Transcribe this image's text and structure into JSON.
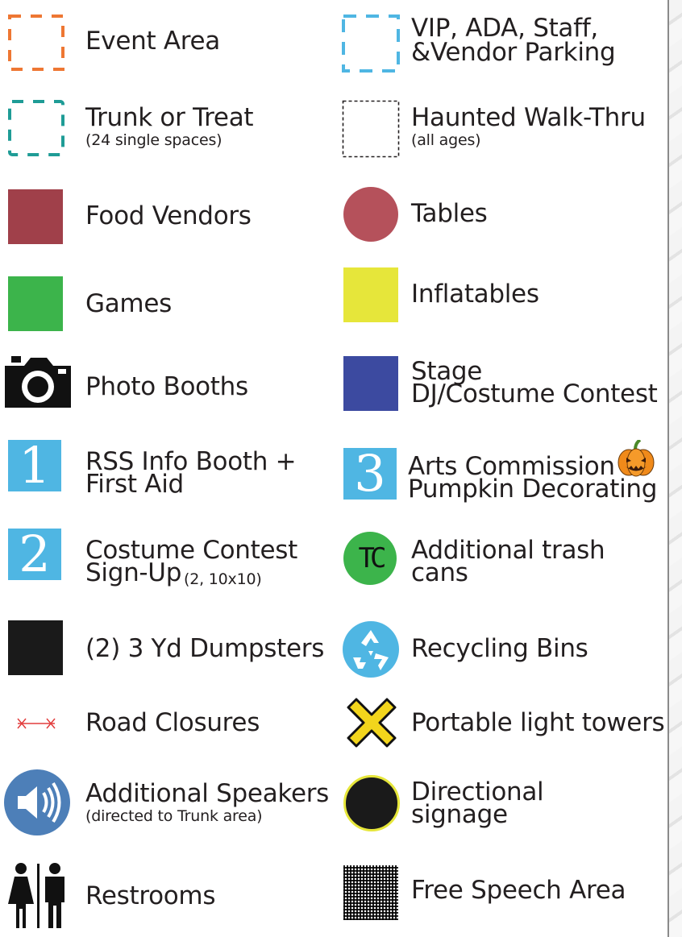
{
  "legend": {
    "left": [
      {
        "key": "event-area",
        "label": "Event Area",
        "icon": "orange-dashed-square-icon",
        "color": "#ee7733"
      },
      {
        "key": "trunk-or-treat",
        "label": "Trunk or Treat",
        "sub": "(24 single spaces)",
        "icon": "teal-dashed-square-icon",
        "color": "#1f9c96"
      },
      {
        "key": "food-vendors",
        "label": "Food Vendors",
        "icon": "maroon-square-icon",
        "color": "#a0404a"
      },
      {
        "key": "games",
        "label": "Games",
        "icon": "green-square-icon",
        "color": "#3cb44b"
      },
      {
        "key": "photo-booths",
        "label": "Photo Booths",
        "icon": "camera-icon"
      },
      {
        "key": "rss-info-booth",
        "label_lines": [
          "RSS Info Booth +",
          "First Aid"
        ],
        "number": "1",
        "icon": "number-1-icon",
        "color": "#4fb6e3"
      },
      {
        "key": "costume-contest",
        "label_lines": [
          "Costume Contest",
          "Sign-Up"
        ],
        "sub": "(2, 10x10)",
        "number": "2",
        "icon": "number-2-icon",
        "color": "#4fb6e3"
      },
      {
        "key": "dumpsters",
        "label": "(2) 3 Yd Dumpsters",
        "icon": "black-square-icon",
        "color": "#1a1a1a"
      },
      {
        "key": "road-closures",
        "label": "Road Closures",
        "icon": "road-closure-icon",
        "color": "#e23d3d"
      },
      {
        "key": "additional-speakers",
        "label": "Additional Speakers",
        "sub": "(directed to Trunk area)",
        "icon": "speaker-icon",
        "color": "#4d7fb8"
      },
      {
        "key": "restrooms",
        "label": "Restrooms",
        "icon": "restroom-icon"
      }
    ],
    "right": [
      {
        "key": "parking",
        "label_lines": [
          "VIP, ADA, Staff,",
          "&Vendor Parking"
        ],
        "icon": "blue-dashed-square-icon",
        "color": "#4fb6e3"
      },
      {
        "key": "haunted-walk-thru",
        "label": "Haunted Walk-Thru",
        "sub": "(all ages)",
        "icon": "black-dashed-square-icon",
        "color": "#231f20"
      },
      {
        "key": "tables",
        "label": "Tables",
        "icon": "pink-circle-icon",
        "color": "#b5515b"
      },
      {
        "key": "inflatables",
        "label": "Inflatables",
        "icon": "yellow-square-icon",
        "color": "#e6e63a"
      },
      {
        "key": "stage",
        "label_lines": [
          "Stage",
          "DJ/Costume Contest"
        ],
        "icon": "blue-square-icon",
        "color": "#3c4aa0"
      },
      {
        "key": "arts-commission",
        "label_lines": [
          "Arts Commission",
          "Pumpkin Decorating"
        ],
        "number": "3",
        "icon": "number-3-icon",
        "color": "#4fb6e3"
      },
      {
        "key": "trash-cans",
        "label_lines": [
          "Additional trash",
          "cans"
        ],
        "icon_text": "TC",
        "icon": "trash-can-circle-icon",
        "color": "#3cb44b"
      },
      {
        "key": "recycling-bins",
        "label": "Recycling Bins",
        "icon": "recycling-icon",
        "color": "#4fb6e3"
      },
      {
        "key": "light-towers",
        "label": "Portable light towers",
        "icon": "yellow-x-icon",
        "color": "#f2d51c"
      },
      {
        "key": "directional-signage",
        "label_lines": [
          "Directional",
          "signage"
        ],
        "icon": "black-circle-icon",
        "color": "#1a1a1a"
      },
      {
        "key": "free-speech-area",
        "label": "Free Speech Area",
        "icon": "grid-pattern-icon"
      }
    ]
  }
}
